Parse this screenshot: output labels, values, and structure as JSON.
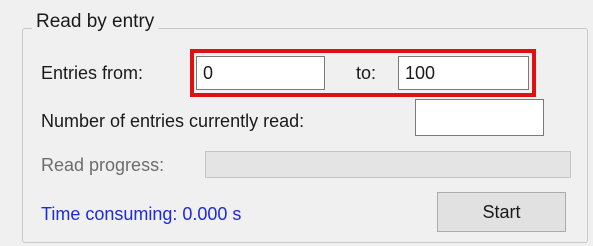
{
  "group": {
    "title": "Read by entry"
  },
  "range": {
    "from_label": "Entries from:",
    "from_value": "0",
    "to_label": "to:",
    "to_value": "100"
  },
  "entries_read": {
    "label": "Number of entries currently read:",
    "value": ""
  },
  "progress": {
    "label": "Read progress:",
    "value": 0
  },
  "status": {
    "time_text": "Time consuming: 0.000 s"
  },
  "actions": {
    "start_label": "Start"
  },
  "colors": {
    "highlight": "#e01010",
    "status_text": "#1d2bd9"
  }
}
